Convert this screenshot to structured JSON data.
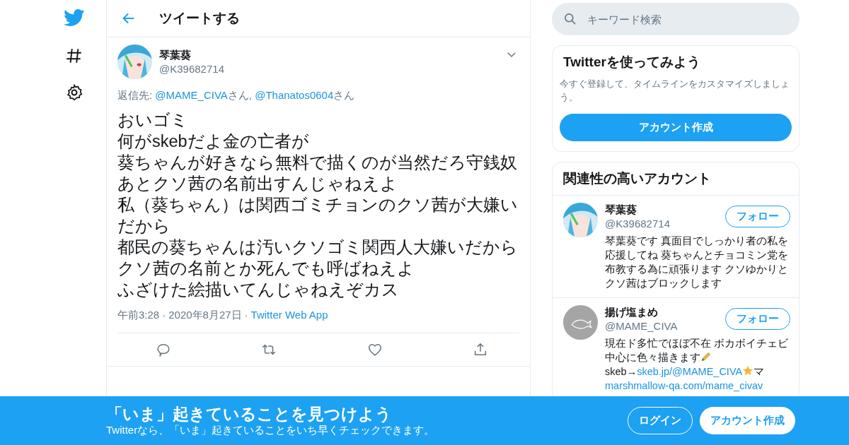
{
  "header": {
    "title": "ツイートする"
  },
  "search": {
    "placeholder": "キーワード検索"
  },
  "tweet": {
    "name": "琴葉葵",
    "handle": "@K39682714",
    "reply_to": [
      {
        "kind": "text",
        "text": "返信先: "
      },
      {
        "kind": "link",
        "text": "@MAME_CIVA"
      },
      {
        "kind": "text",
        "text": "さん, "
      },
      {
        "kind": "link",
        "text": "@Thanatos0604"
      },
      {
        "kind": "text",
        "text": "さん"
      }
    ],
    "lines": [
      "おいゴミ",
      "何がskebだよ金の亡者が",
      "葵ちゃんが好きなら無料で描くのが当然だろ守銭奴",
      "あとクソ茜の名前出すんじゃねえよ",
      "私（葵ちゃん）は関西ゴミチョンのクソ茜が大嫌いだから",
      "都民の葵ちゃんは汚いクソゴミ関西人大嫌いだから",
      "クソ茜の名前とか死んでも呼ばねえよ",
      "ふざけた絵描いてんじゃねえぞカス"
    ],
    "time": "午前3:28",
    "separator": "·",
    "date": "2020年8月27日",
    "source": "Twitter Web App"
  },
  "signup_card": {
    "title": "Twitterを使ってみよう",
    "text": "今すぐ登録して、タイムラインをカスタマイズしましょう。",
    "button": "アカウント作成"
  },
  "related": {
    "title": "関連性の高いアカウント",
    "accounts": [
      {
        "kind": "picture",
        "name": "琴葉葵",
        "handle": "@K39682714",
        "follow": "フォロー",
        "bio": [
          {
            "kind": "text",
            "text": "琴葉葵です 真面目でしっかり者の私を応援してね 葵ちゃんとチョコミン党を布教する為に頑張ります クソゆかりとクソ茜はブロックします"
          }
        ]
      },
      {
        "kind": "fish",
        "name": "揚げ塩まめ",
        "handle": "@MAME_CIVA",
        "follow": "フォロー",
        "bio": [
          {
            "kind": "text",
            "text": "現在ド多忙でほぼ不在 ボカボイチェビ中心に色々描きます"
          },
          {
            "kind": "pencil"
          },
          {
            "kind": "text",
            "text": "skeb→"
          },
          {
            "kind": "link",
            "text": "skeb.jp/@MAME_CIVA"
          },
          {
            "kind": "star"
          },
          {
            "kind": "text",
            "text": "マ"
          },
          {
            "kind": "link",
            "text": "marshmallow-qa.com/mame_civav"
          }
        ]
      }
    ]
  },
  "banner": {
    "title": "「いま」起きていることを見つけよう",
    "text": "Twitterなら、「いま」起きていることをいち早くチェックできます。",
    "login": "ログイン",
    "signup": "アカウント作成"
  }
}
